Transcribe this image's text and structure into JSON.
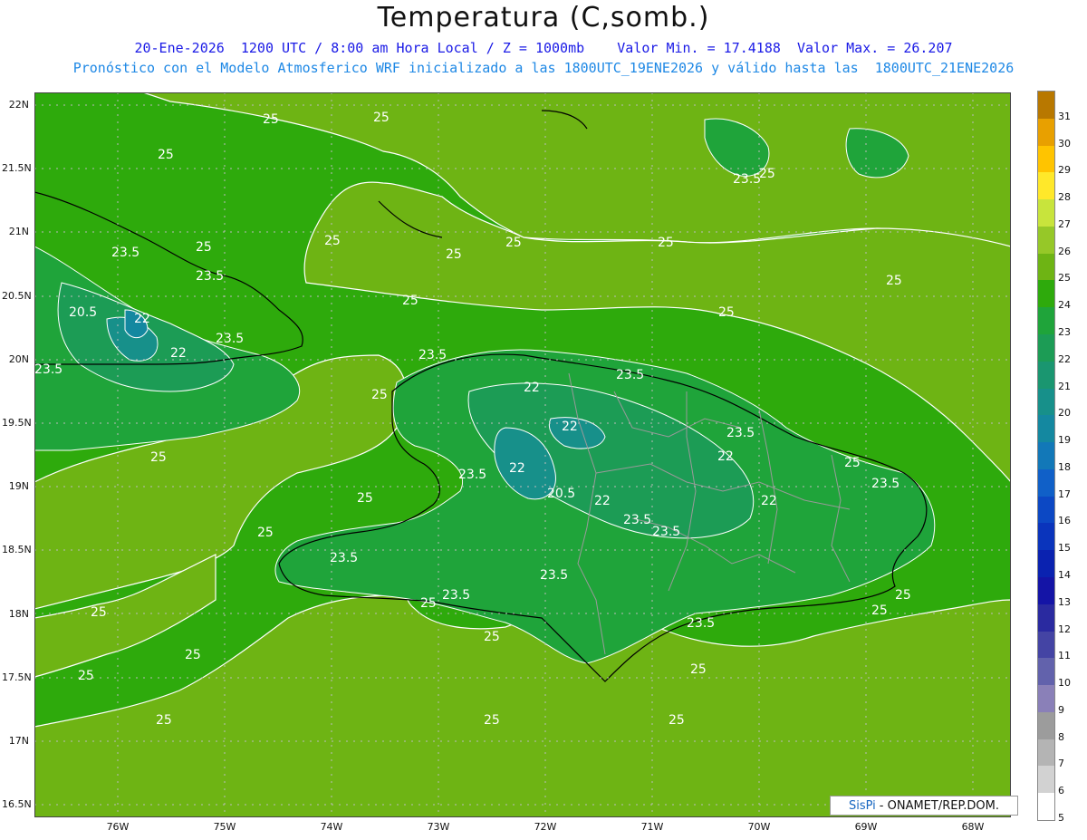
{
  "title": "Temperatura (C,somb.)",
  "subtitle_line1": "20-Ene-2026  1200 UTC / 8:00 am Hora Local / Z = 1000mb    Valor Min. = 17.4188  Valor Max. = 26.207",
  "subtitle_line2": "Pronóstico con el Modelo Atmosferico WRF inicializado a las 1800UTC_19ENE2026 y válido hasta las  1800UTC_21ENE2026",
  "lat_labels": [
    "22N",
    "21.5N",
    "21N",
    "20.5N",
    "20N",
    "19.5N",
    "19N",
    "18.5N",
    "18N",
    "17.5N",
    "17N",
    "16.5N"
  ],
  "lon_labels": [
    "76W",
    "75W",
    "74W",
    "73W",
    "72W",
    "71W",
    "70W",
    "69W",
    "68W"
  ],
  "colorbar": {
    "labels": [
      "31",
      "30",
      "29",
      "28",
      "27",
      "26",
      "25",
      "24",
      "23",
      "22",
      "21",
      "20",
      "19",
      "18",
      "17",
      "16",
      "15",
      "14",
      "13",
      "12",
      "11",
      "10",
      "9",
      "8",
      "7",
      "6",
      "5"
    ],
    "colors": [
      "#b87800",
      "#e8a000",
      "#ffc400",
      "#ffe82a",
      "#c8e43c",
      "#96c828",
      "#6eb414",
      "#2eaa0c",
      "#1fa43a",
      "#1c9c55",
      "#1a9670",
      "#17908a",
      "#1488a0",
      "#1278b8",
      "#1060c8",
      "#0c48c4",
      "#0a34bc",
      "#0a22b0",
      "#1414a6",
      "#2a2aa0",
      "#4444a4",
      "#6262ac",
      "#8a80b8",
      "#9c9c9c",
      "#b4b4b4",
      "#d2d2d2",
      "#ffffff"
    ]
  },
  "contour_labels": {
    "c25": "25",
    "c235": "23.5",
    "c22": "22",
    "c205": "20.5"
  },
  "credit": {
    "brand": "SisPi",
    "text": "- ONAMET/REP.DOM."
  }
}
